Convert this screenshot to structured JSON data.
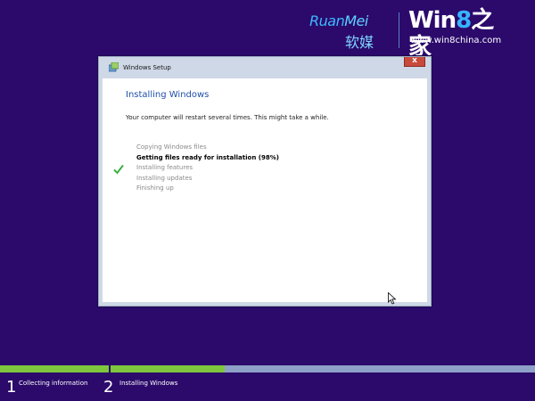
{
  "watermark": {
    "brand_en_ruan": "Ruan",
    "brand_en_mei": "Mei",
    "brand_cn": "软媒",
    "win8_prefix": "Win",
    "win8_num": "8",
    "win8_suffix": "之家",
    "site": "www.win8china.com"
  },
  "dialog": {
    "title": "Windows Setup",
    "heading": "Installing Windows",
    "subtitle": "Your computer will restart several times. This might take a while.",
    "steps": [
      {
        "label": "Copying Windows files",
        "state": "done"
      },
      {
        "label": "Getting files ready for installation (98%)",
        "state": "active"
      },
      {
        "label": "Installing features",
        "state": "pending"
      },
      {
        "label": "Installing updates",
        "state": "pending"
      },
      {
        "label": "Finishing up",
        "state": "pending"
      }
    ],
    "close_glyph": "x",
    "icons": {
      "app": "windows-setup-icon",
      "check": "checkmark-icon",
      "cursor": "mouse-cursor-icon"
    }
  },
  "progress": {
    "fraction": 0.42,
    "fill_color": "#7ec63d",
    "track_color": "#8ea0c8"
  },
  "stages": [
    {
      "number": "1",
      "label": "Collecting information"
    },
    {
      "number": "2",
      "label": "Installing Windows"
    }
  ],
  "colors": {
    "background": "#2b0a6b",
    "heading": "#1f4fa8",
    "close": "#c74b3d"
  }
}
